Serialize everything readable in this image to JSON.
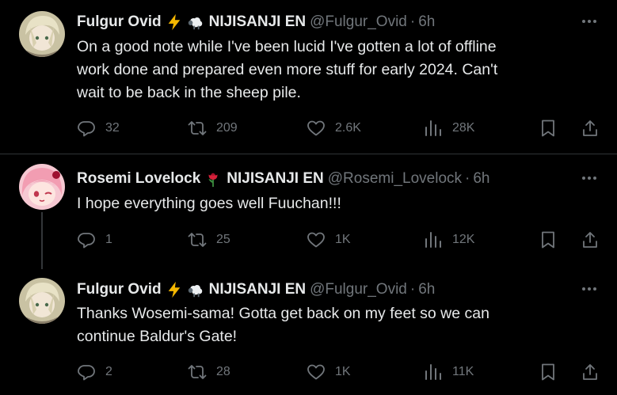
{
  "tweets": [
    {
      "name": "Fulgur Ovid",
      "org": "NIJISANJI EN",
      "handle": "@Fulgur_Ovid",
      "time": "6h",
      "text": "On a good note while I've been lucid I've gotten a lot of offline\nwork done and prepared even more stuff for early 2024. Can't\nwait to be back in the sheep pile.",
      "replies": "32",
      "reposts": "209",
      "likes": "2.6K",
      "views": "28K"
    },
    {
      "name": "Rosemi Lovelock",
      "org": "NIJISANJI EN",
      "handle": "@Rosemi_Lovelock",
      "time": "6h",
      "text": "I hope everything goes well Fuuchan!!!",
      "replies": "1",
      "reposts": "25",
      "likes": "1K",
      "views": "12K"
    },
    {
      "name": "Fulgur Ovid",
      "org": "NIJISANJI EN",
      "handle": "@Fulgur_Ovid",
      "time": "6h",
      "text": "Thanks Wosemi-sama! Gotta get back on my feet so we can\ncontinue Baldur's Gate!",
      "replies": "2",
      "reposts": "28",
      "likes": "1K",
      "views": "11K"
    }
  ],
  "separator": "·",
  "icons": {
    "author1_emojis": [
      "lightning-icon",
      "sheep-icon"
    ],
    "author2_emojis": [
      "rose-icon"
    ],
    "actions": [
      "reply-icon",
      "repost-icon",
      "like-icon",
      "views-icon",
      "bookmark-icon",
      "share-icon"
    ]
  },
  "colors": {
    "background": "#000000",
    "text": "#e7e9ea",
    "secondary": "#71767b",
    "divider": "#2f3336"
  }
}
